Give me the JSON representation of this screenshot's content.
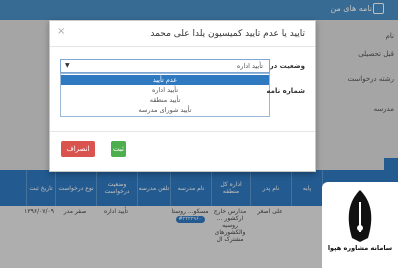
{
  "background": {
    "header_title": "نامه های من",
    "side_labels": [
      "نام",
      "قبل تحصیلی",
      "رشته درخواست",
      "مدرسه"
    ],
    "table_headers": [
      "تاریخ ثبت",
      "نوع درخواست",
      "وضعیت درخواست",
      "تلفن مدرسه",
      "نام مدرسه",
      "اداره کل منطقه",
      "نام پدر",
      "پایه",
      "نام"
    ],
    "row": {
      "date": "۱۳۹۶/۰۷/۰۹",
      "type": "صفر مدر",
      "status": "تأیید اداره",
      "school": "مسکو... روستا",
      "school_badge": "#۲۲۲۲۹۶۰",
      "office": "مدارس خارج ارکشور ... روسیه والکشورهای مشترک ال",
      "father": "علی اصغر",
      "grade": "",
      "name": "علی"
    }
  },
  "modal": {
    "title": "تایید یا عدم تایید کمیسیون یلدا علی محمد",
    "close": "×",
    "status_label": "وضعیت درخواست",
    "status_value": "تأیید اداره",
    "options": [
      "عدم تأیید",
      "تأیید اداره",
      "تأیید منطقه",
      "تأیید شورای مدرسه"
    ],
    "selected_index": 0,
    "letter_label": "شماره نامه",
    "save_label": "ثبت",
    "cancel_label": "انصراف"
  },
  "watermark": {
    "brand": "سامانه مشاوره هپوا"
  },
  "colors": {
    "primary": "#2f79c0",
    "success": "#4cae4c",
    "danger": "#d9534f"
  }
}
